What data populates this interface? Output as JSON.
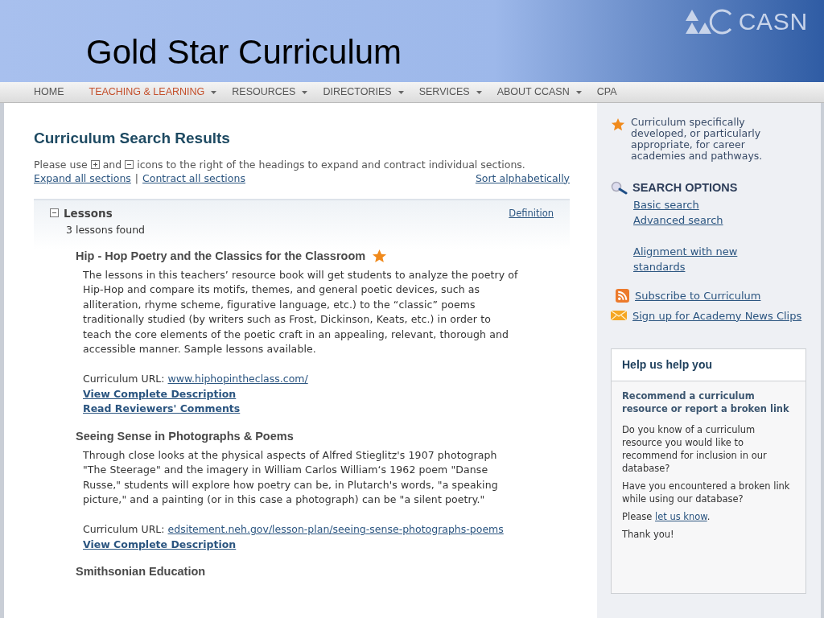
{
  "slide": {
    "title": "Gold Star Curriculum",
    "logo": "CASN"
  },
  "nav": [
    {
      "label": "HOME",
      "selected": false,
      "has_menu": false
    },
    {
      "label": "TEACHING & LEARNING",
      "selected": true,
      "has_menu": true
    },
    {
      "label": "RESOURCES",
      "selected": false,
      "has_menu": true
    },
    {
      "label": "DIRECTORIES",
      "selected": false,
      "has_menu": true
    },
    {
      "label": "SERVICES",
      "selected": false,
      "has_menu": true
    },
    {
      "label": "ABOUT CCASN",
      "selected": false,
      "has_menu": true
    },
    {
      "label": "CPA",
      "selected": false,
      "has_menu": false
    }
  ],
  "main": {
    "heading": "Curriculum Search Results",
    "instructions": [
      "Please use",
      "and",
      "icons to the right of the headings to expand and contract individual sections."
    ],
    "links": [
      "Expand all sections",
      "Contract all sections"
    ],
    "separator": "|",
    "sort_link": "Sort alphabetically",
    "section": {
      "title": "Lessons",
      "expanded": true,
      "count": "3 lessons found",
      "definition_link": "Definition",
      "items": [
        {
          "title": "Hip - Hop Poetry and the Classics for the Classroom",
          "gold_star": true,
          "description": "The lessons in this teachers’ resource book will get students to analyze the poetry of Hip-Hop and compare its motifs, themes, and general poetic devices, such as alliteration, rhyme scheme, figurative language, etc.) to the “classic” poems traditionally studied (by writers such as Frost, Dickinson, Keats, etc.) in order to teach the core elements of the poetic craft in an appealing, relevant, thorough and accessible manner. Sample lessons available.",
          "url_label": "Curriculum URL:",
          "url": "www.hiphopintheclass.com/",
          "links": [
            "View Complete Description",
            "Read Reviewers' Comments"
          ]
        },
        {
          "title": "Seeing Sense in Photographs & Poems",
          "gold_star": false,
          "description": "Through close looks at the physical aspects of Alfred Stieglitz's 1907 photograph \"The Steerage\" and the imagery in William Carlos William‘s 1962 poem \"Danse Russe,\" students will explore how poetry can be, in Plutarch's words, \"a speaking picture,\" and a painting (or in this case a photograph) can be \"a silent poetry.\"",
          "url_label": "Curriculum URL:",
          "url": "edsitement.neh.gov/lesson-plan/seeing-sense-photographs-poems",
          "links": [
            "View Complete Description"
          ]
        },
        {
          "title": "Smithsonian Education",
          "gold_star": false
        }
      ]
    }
  },
  "sidebar": {
    "legend": "Curriculum specifically developed, or particularly appropriate, for career academies and pathways.",
    "search_title": "SEARCH OPTIONS",
    "search_links": [
      "Basic search",
      "Advanced search"
    ],
    "alignment_link": "Alignment with new standards",
    "feeds": [
      {
        "kind": "rss",
        "label": "Subscribe to Curriculum"
      },
      {
        "kind": "mail",
        "label": "Sign up for Academy News Clips"
      }
    ],
    "help": {
      "title": "Help us help you",
      "subtitle": "Recommend a curriculum resource or report a broken link",
      "paragraphs": [
        "Do you know of a curriculum resource you would like to recommend for inclusion in our database?",
        "Have you encountered a broken link while using our database?"
      ],
      "contact": {
        "before": "Please",
        "link": "let us know",
        "after": "."
      },
      "closing": "Thank you!"
    }
  }
}
